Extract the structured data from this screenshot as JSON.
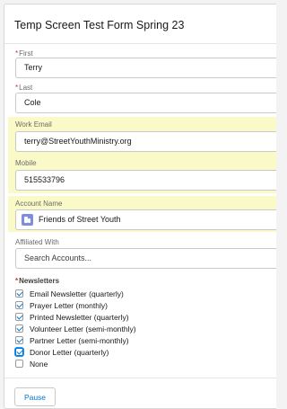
{
  "form": {
    "title": "Temp Screen Test Form Spring 23"
  },
  "fields": {
    "first": {
      "required_marker": "*",
      "label": "First",
      "value": "Terry"
    },
    "last": {
      "required_marker": "*",
      "label": "Last",
      "value": "Cole"
    },
    "work_email": {
      "label": "Work Email",
      "value": "terry@StreetYouthMinistry.org"
    },
    "mobile": {
      "label": "Mobile",
      "value": "515533796"
    },
    "account_name": {
      "label": "Account Name",
      "value": "Friends of Street Youth",
      "icon": "account-icon",
      "icon_color": "#7f8de1"
    },
    "affiliated_with": {
      "label": "Affiliated With",
      "placeholder": "Search Accounts..."
    }
  },
  "newsletters": {
    "required_marker": "*",
    "label": "Newsletters",
    "options": [
      {
        "label": "Email Newsletter (quarterly)",
        "checked": true
      },
      {
        "label": "Prayer Letter (monthly)",
        "checked": true
      },
      {
        "label": "Printed Newsletter (quarterly)",
        "checked": true
      },
      {
        "label": "Volunteer Letter (semi-monthly)",
        "checked": true
      },
      {
        "label": "Partner Letter (semi-monthly)",
        "checked": true
      },
      {
        "label": "Donor Letter (quarterly)",
        "checked": true,
        "focused": true
      },
      {
        "label": "None",
        "checked": false
      }
    ]
  },
  "footer": {
    "pause_label": "Pause"
  },
  "colors": {
    "highlight_band": "#fafac8",
    "accent": "#0176d3",
    "required": "#c23934"
  }
}
